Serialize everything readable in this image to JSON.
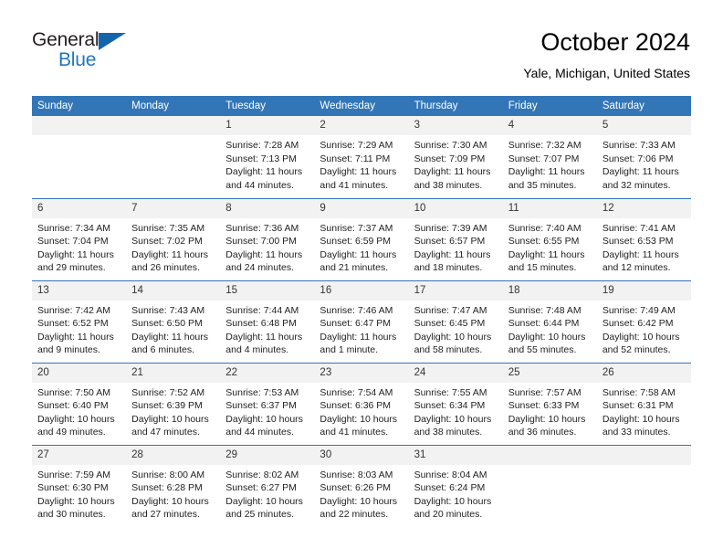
{
  "brand": {
    "name_part1": "General",
    "name_part2": "Blue",
    "triangle_color": "#1565ac",
    "blue_color": "#1f76c2"
  },
  "header": {
    "title": "October 2024",
    "subtitle": "Yale, Michigan, United States"
  },
  "theme": {
    "header_bar": "#3276b8",
    "daynum_bg": "#f2f2f2",
    "row_border": "#3276b8"
  },
  "weekdays": [
    "Sunday",
    "Monday",
    "Tuesday",
    "Wednesday",
    "Thursday",
    "Friday",
    "Saturday"
  ],
  "labels": {
    "sunrise_prefix": "Sunrise:",
    "sunset_prefix": "Sunset:",
    "daylight_prefix": "Daylight:"
  },
  "weeks": [
    [
      {
        "day": "",
        "empty": true
      },
      {
        "day": "",
        "empty": true
      },
      {
        "day": "1",
        "sunrise": "Sunrise: 7:28 AM",
        "sunset": "Sunset: 7:13 PM",
        "daylight": "Daylight: 11 hours and 44 minutes."
      },
      {
        "day": "2",
        "sunrise": "Sunrise: 7:29 AM",
        "sunset": "Sunset: 7:11 PM",
        "daylight": "Daylight: 11 hours and 41 minutes."
      },
      {
        "day": "3",
        "sunrise": "Sunrise: 7:30 AM",
        "sunset": "Sunset: 7:09 PM",
        "daylight": "Daylight: 11 hours and 38 minutes."
      },
      {
        "day": "4",
        "sunrise": "Sunrise: 7:32 AM",
        "sunset": "Sunset: 7:07 PM",
        "daylight": "Daylight: 11 hours and 35 minutes."
      },
      {
        "day": "5",
        "sunrise": "Sunrise: 7:33 AM",
        "sunset": "Sunset: 7:06 PM",
        "daylight": "Daylight: 11 hours and 32 minutes."
      }
    ],
    [
      {
        "day": "6",
        "sunrise": "Sunrise: 7:34 AM",
        "sunset": "Sunset: 7:04 PM",
        "daylight": "Daylight: 11 hours and 29 minutes."
      },
      {
        "day": "7",
        "sunrise": "Sunrise: 7:35 AM",
        "sunset": "Sunset: 7:02 PM",
        "daylight": "Daylight: 11 hours and 26 minutes."
      },
      {
        "day": "8",
        "sunrise": "Sunrise: 7:36 AM",
        "sunset": "Sunset: 7:00 PM",
        "daylight": "Daylight: 11 hours and 24 minutes."
      },
      {
        "day": "9",
        "sunrise": "Sunrise: 7:37 AM",
        "sunset": "Sunset: 6:59 PM",
        "daylight": "Daylight: 11 hours and 21 minutes."
      },
      {
        "day": "10",
        "sunrise": "Sunrise: 7:39 AM",
        "sunset": "Sunset: 6:57 PM",
        "daylight": "Daylight: 11 hours and 18 minutes."
      },
      {
        "day": "11",
        "sunrise": "Sunrise: 7:40 AM",
        "sunset": "Sunset: 6:55 PM",
        "daylight": "Daylight: 11 hours and 15 minutes."
      },
      {
        "day": "12",
        "sunrise": "Sunrise: 7:41 AM",
        "sunset": "Sunset: 6:53 PM",
        "daylight": "Daylight: 11 hours and 12 minutes."
      }
    ],
    [
      {
        "day": "13",
        "sunrise": "Sunrise: 7:42 AM",
        "sunset": "Sunset: 6:52 PM",
        "daylight": "Daylight: 11 hours and 9 minutes."
      },
      {
        "day": "14",
        "sunrise": "Sunrise: 7:43 AM",
        "sunset": "Sunset: 6:50 PM",
        "daylight": "Daylight: 11 hours and 6 minutes."
      },
      {
        "day": "15",
        "sunrise": "Sunrise: 7:44 AM",
        "sunset": "Sunset: 6:48 PM",
        "daylight": "Daylight: 11 hours and 4 minutes."
      },
      {
        "day": "16",
        "sunrise": "Sunrise: 7:46 AM",
        "sunset": "Sunset: 6:47 PM",
        "daylight": "Daylight: 11 hours and 1 minute."
      },
      {
        "day": "17",
        "sunrise": "Sunrise: 7:47 AM",
        "sunset": "Sunset: 6:45 PM",
        "daylight": "Daylight: 10 hours and 58 minutes."
      },
      {
        "day": "18",
        "sunrise": "Sunrise: 7:48 AM",
        "sunset": "Sunset: 6:44 PM",
        "daylight": "Daylight: 10 hours and 55 minutes."
      },
      {
        "day": "19",
        "sunrise": "Sunrise: 7:49 AM",
        "sunset": "Sunset: 6:42 PM",
        "daylight": "Daylight: 10 hours and 52 minutes."
      }
    ],
    [
      {
        "day": "20",
        "sunrise": "Sunrise: 7:50 AM",
        "sunset": "Sunset: 6:40 PM",
        "daylight": "Daylight: 10 hours and 49 minutes."
      },
      {
        "day": "21",
        "sunrise": "Sunrise: 7:52 AM",
        "sunset": "Sunset: 6:39 PM",
        "daylight": "Daylight: 10 hours and 47 minutes."
      },
      {
        "day": "22",
        "sunrise": "Sunrise: 7:53 AM",
        "sunset": "Sunset: 6:37 PM",
        "daylight": "Daylight: 10 hours and 44 minutes."
      },
      {
        "day": "23",
        "sunrise": "Sunrise: 7:54 AM",
        "sunset": "Sunset: 6:36 PM",
        "daylight": "Daylight: 10 hours and 41 minutes."
      },
      {
        "day": "24",
        "sunrise": "Sunrise: 7:55 AM",
        "sunset": "Sunset: 6:34 PM",
        "daylight": "Daylight: 10 hours and 38 minutes."
      },
      {
        "day": "25",
        "sunrise": "Sunrise: 7:57 AM",
        "sunset": "Sunset: 6:33 PM",
        "daylight": "Daylight: 10 hours and 36 minutes."
      },
      {
        "day": "26",
        "sunrise": "Sunrise: 7:58 AM",
        "sunset": "Sunset: 6:31 PM",
        "daylight": "Daylight: 10 hours and 33 minutes."
      }
    ],
    [
      {
        "day": "27",
        "sunrise": "Sunrise: 7:59 AM",
        "sunset": "Sunset: 6:30 PM",
        "daylight": "Daylight: 10 hours and 30 minutes."
      },
      {
        "day": "28",
        "sunrise": "Sunrise: 8:00 AM",
        "sunset": "Sunset: 6:28 PM",
        "daylight": "Daylight: 10 hours and 27 minutes."
      },
      {
        "day": "29",
        "sunrise": "Sunrise: 8:02 AM",
        "sunset": "Sunset: 6:27 PM",
        "daylight": "Daylight: 10 hours and 25 minutes."
      },
      {
        "day": "30",
        "sunrise": "Sunrise: 8:03 AM",
        "sunset": "Sunset: 6:26 PM",
        "daylight": "Daylight: 10 hours and 22 minutes."
      },
      {
        "day": "31",
        "sunrise": "Sunrise: 8:04 AM",
        "sunset": "Sunset: 6:24 PM",
        "daylight": "Daylight: 10 hours and 20 minutes."
      },
      {
        "day": "",
        "empty": true
      },
      {
        "day": "",
        "empty": true
      }
    ]
  ]
}
